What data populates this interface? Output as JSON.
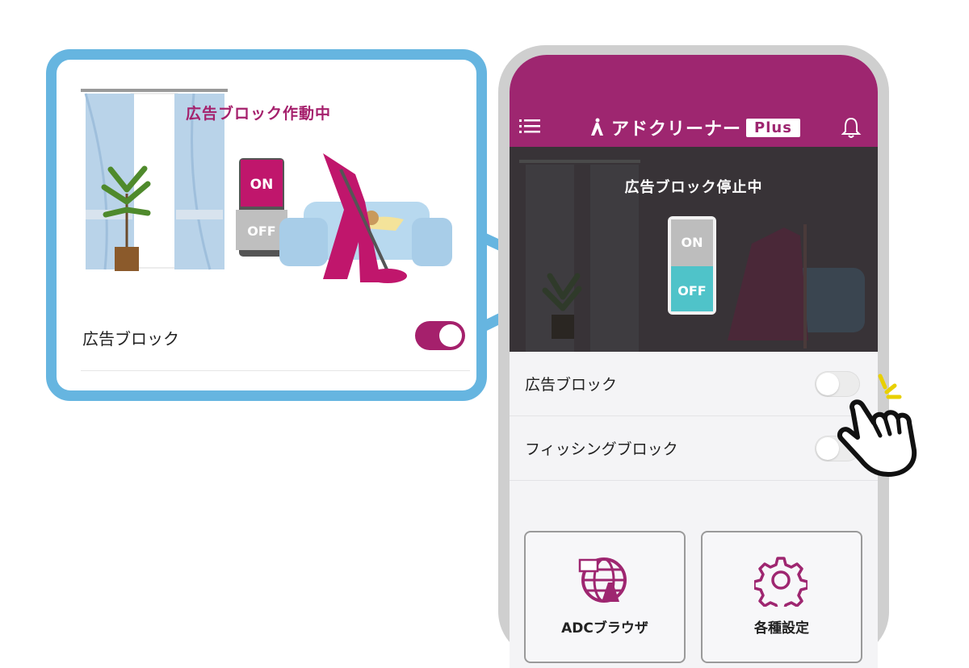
{
  "callout": {
    "status_title": "広告ブロック作動中",
    "switch_on": "ON",
    "switch_off": "OFF",
    "ad_block_label": "広告ブロック",
    "ad_block_enabled": true
  },
  "app": {
    "brand_name": "アドクリーナー",
    "brand_plus": "Plus",
    "icons": {
      "menu": "menu-icon",
      "bell": "bell-icon",
      "browser": "globe-browser-icon",
      "settings": "gear-icon"
    },
    "hero": {
      "status_title": "広告ブロック停止中",
      "switch_on": "ON",
      "switch_off": "OFF"
    },
    "toggles": [
      {
        "label": "広告ブロック",
        "enabled": false
      },
      {
        "label": "フィッシングブロック",
        "enabled": false
      }
    ],
    "tiles": [
      {
        "label": "ADCブラウザ"
      },
      {
        "label": "各種設定"
      }
    ]
  },
  "colors": {
    "brand": "#9e2670",
    "callout_border": "#66b5e0",
    "switch_off": "#4fc3c9"
  }
}
